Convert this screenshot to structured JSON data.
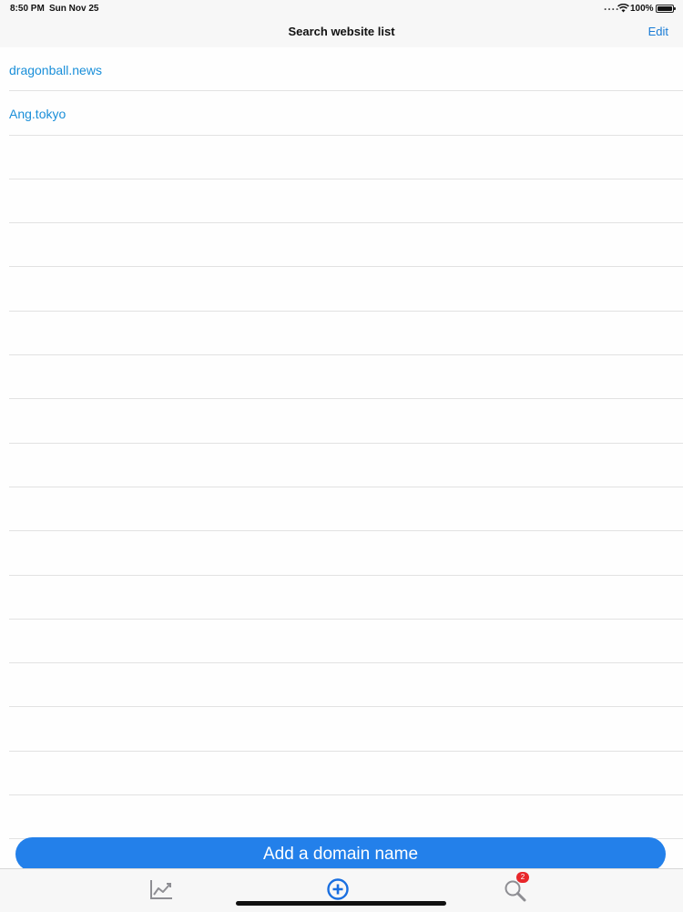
{
  "status": {
    "time": "8:50 PM",
    "date": "Sun Nov 25",
    "dots": "....",
    "battery_pct": "100%"
  },
  "nav": {
    "title": "Search website list",
    "edit_label": "Edit"
  },
  "rows": [
    {
      "label": "dragonball.news"
    },
    {
      "label": "Ang.tokyo"
    },
    {
      "label": ""
    },
    {
      "label": ""
    },
    {
      "label": ""
    },
    {
      "label": ""
    },
    {
      "label": ""
    },
    {
      "label": ""
    },
    {
      "label": ""
    },
    {
      "label": ""
    },
    {
      "label": ""
    },
    {
      "label": ""
    },
    {
      "label": ""
    },
    {
      "label": ""
    },
    {
      "label": ""
    },
    {
      "label": ""
    },
    {
      "label": ""
    },
    {
      "label": ""
    }
  ],
  "add_button": {
    "label": "Add a domain name"
  },
  "tabs": {
    "search_badge": "2",
    "icons": [
      "chart-icon",
      "add-circle-icon",
      "search-icon"
    ]
  },
  "colors": {
    "accent": "#2380ea",
    "link": "#1a8fd9",
    "badge": "#e8262a"
  }
}
